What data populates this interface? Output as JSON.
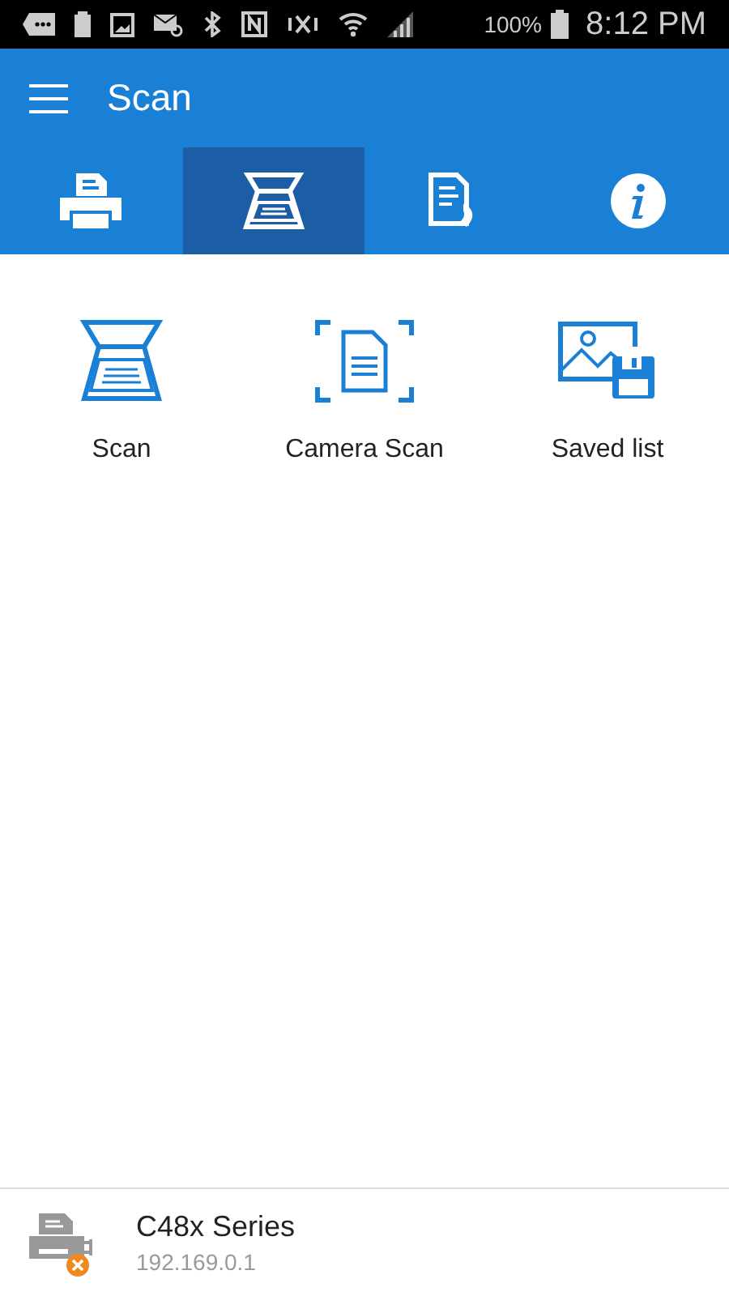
{
  "status_bar": {
    "icons": [
      {
        "kind": "message"
      },
      {
        "kind": "battery-100"
      },
      {
        "kind": "image"
      },
      {
        "kind": "mail"
      },
      {
        "kind": "bluetooth"
      },
      {
        "kind": "nfc"
      },
      {
        "kind": "vibrate"
      },
      {
        "kind": "wifi"
      },
      {
        "kind": "signal"
      }
    ],
    "battery": "100%",
    "time": "8:12 PM"
  },
  "app_bar": {
    "title": "Scan"
  },
  "tabs": [
    {
      "kind": "print",
      "selected": false
    },
    {
      "kind": "scan",
      "selected": true
    },
    {
      "kind": "fax",
      "selected": false
    },
    {
      "kind": "info",
      "selected": false
    }
  ],
  "actions": [
    {
      "kind": "scan",
      "label": "Scan"
    },
    {
      "kind": "camera",
      "label": "Camera Scan"
    },
    {
      "kind": "saved",
      "label": "Saved list"
    }
  ],
  "device": {
    "name": "C48x Series",
    "address": "192.169.0.1",
    "error": true
  }
}
